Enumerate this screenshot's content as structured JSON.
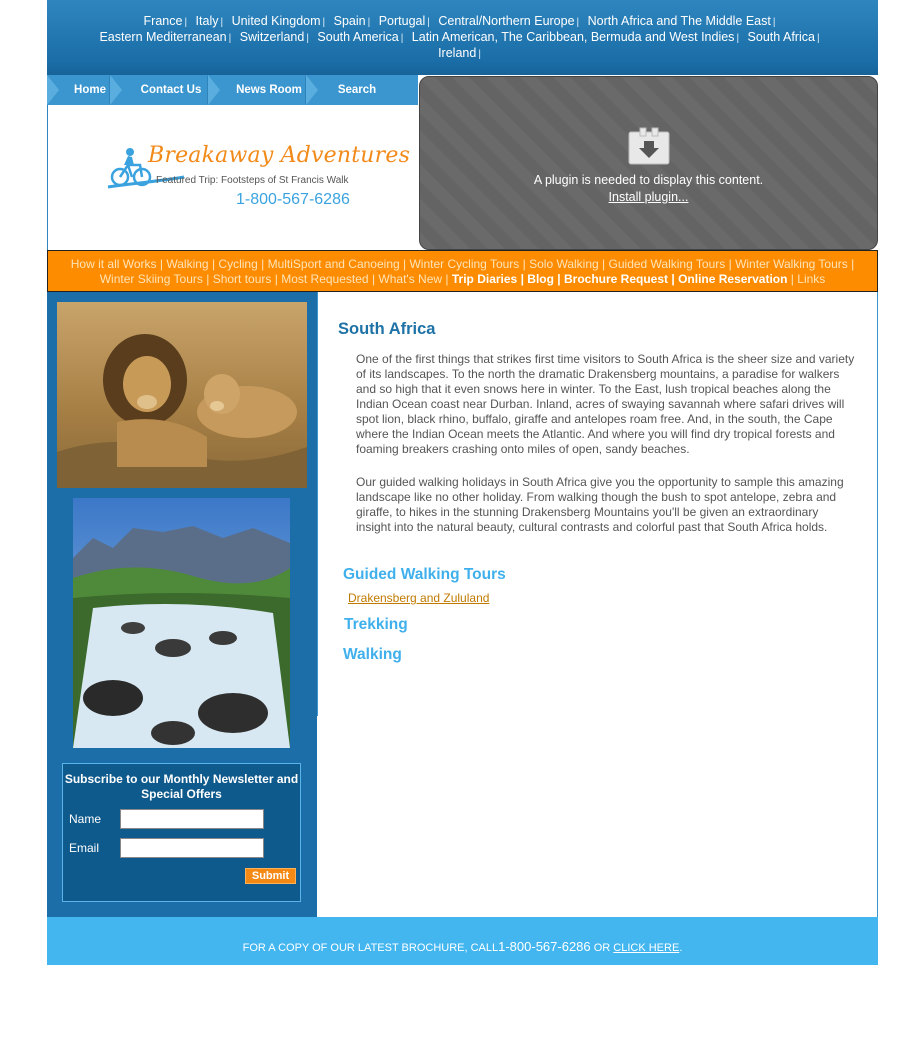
{
  "countries": [
    "France",
    "Italy",
    "United Kingdom",
    "Spain",
    "Portugal",
    "Central/Northern Europe",
    "North Africa and The Middle East",
    "Eastern Mediterranean",
    "Switzerland",
    "South America",
    "Latin American, The Caribbean, Bermuda and West Indies",
    "South Africa",
    "Ireland"
  ],
  "country_separator": "|",
  "nav": {
    "home": "Home",
    "contact": "Contact Us",
    "news": "News Room",
    "search": "Search"
  },
  "logo": {
    "name": "Breakaway Adventures",
    "featured": "Featured Trip: Footsteps of St Francis Walk",
    "phone": "1-800-567-6286"
  },
  "plugin": {
    "message": "A plugin is needed to display this content.",
    "install": "Install plugin..."
  },
  "categories": {
    "how": "How it all Works",
    "walking": "Walking",
    "cycling": "Cycling",
    "multisport": "MultiSport and Canoeing",
    "winter_cycling": "Winter Cycling Tours",
    "solo": "Solo Walking",
    "guided": "Guided Walking Tours",
    "winter_walking": "Winter Walking Tours",
    "winter_skiing": "Winter Skiing Tours",
    "short": "Short tours",
    "requested": "Most Requested",
    "new": "What's New",
    "diaries": "Trip Diaries",
    "blog": "Blog",
    "brochure": "Brochure Request",
    "reservation": "Online Reservation",
    "links": "Links",
    "sep": "|"
  },
  "newsletter": {
    "title": "Subscribe to our Monthly Newsletter and Special Offers",
    "name_label": "Name",
    "email_label": "Email",
    "name_value": "",
    "email_value": "",
    "submit": "Submit"
  },
  "main": {
    "title": "South Africa",
    "para1": "One of the first things that strikes first time visitors to South Africa is the sheer size and variety of its landscapes. To the north the dramatic Drakensberg mountains, a paradise for walkers and so high that it even snows here in winter. To the East, lush tropical beaches along the Indian Ocean coast near Durban. Inland, acres of swaying savannah where safari drives will spot lion, black rhino, buffalo, giraffe and antelopes roam free. And, in the south, the Cape where the Indian Ocean meets the Atlantic. And where you will find dry tropical forests and foaming breakers crashing onto miles of open, sandy beaches.",
    "para2": "Our guided walking holidays in South Africa give you the opportunity to sample this amazing landscape like no other holiday. From walking though the bush to spot antelope, zebra and giraffe, to hikes in the stunning Drakensberg Mountains you'll be given an extraordinary insight into the natural beauty, cultural contrasts and colorful past that South Africa holds.",
    "section_guided": "Guided Walking Tours",
    "link_drakensberg": "Drakensberg and Zululand",
    "section_trekking": "Trekking",
    "section_walking": "Walking"
  },
  "footer": {
    "prefix": "FOR A COPY OF OUR LATEST BROCHURE, CALL",
    "phone": "1-800-567-6286",
    "or": "OR",
    "link": "CLICK HERE",
    "suffix": "."
  },
  "colors": {
    "header_blue": "#1b6ea8",
    "orange": "#fd8c00",
    "accent": "#3fb0ec"
  }
}
